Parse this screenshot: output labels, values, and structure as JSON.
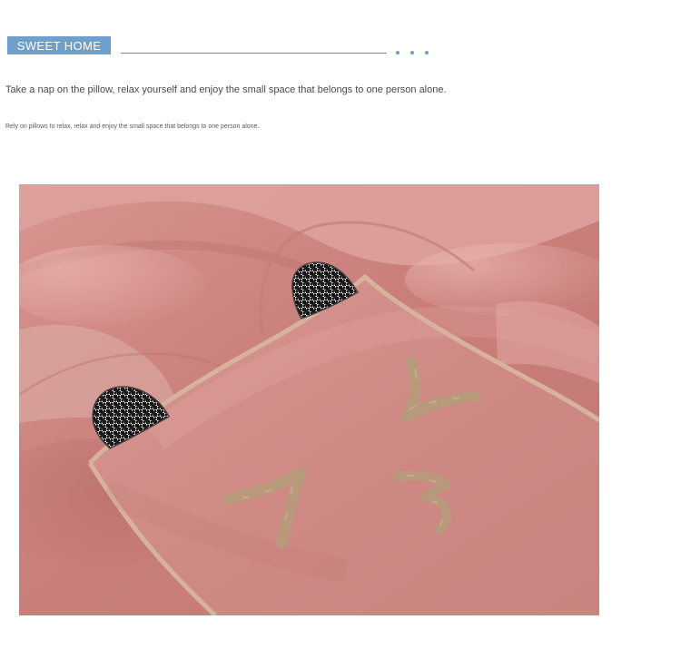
{
  "header": {
    "badge_label": "SWEET HOME",
    "badge_color": "#6f9fcb",
    "dot_color": "#6f9fcb"
  },
  "content": {
    "line_1": "Take a nap on the pillow, relax yourself and enjoy the small space that belongs to one person alone.",
    "line_2": "Rely on pillows to relax, relax and enjoy the small space that belongs to one person alone."
  },
  "photo": {
    "subject": "pink velvet quilt pillow with houndstooth ears and embroidered face",
    "colors": {
      "fabric": "#cf8a86",
      "fabric_light": "#e1a7a3",
      "fabric_dark": "#b9706c",
      "piping": "#d7b39e",
      "embroidery": "#b89a7b",
      "houndstooth_dark": "#171717",
      "houndstooth_light": "#f6f1ef"
    }
  }
}
